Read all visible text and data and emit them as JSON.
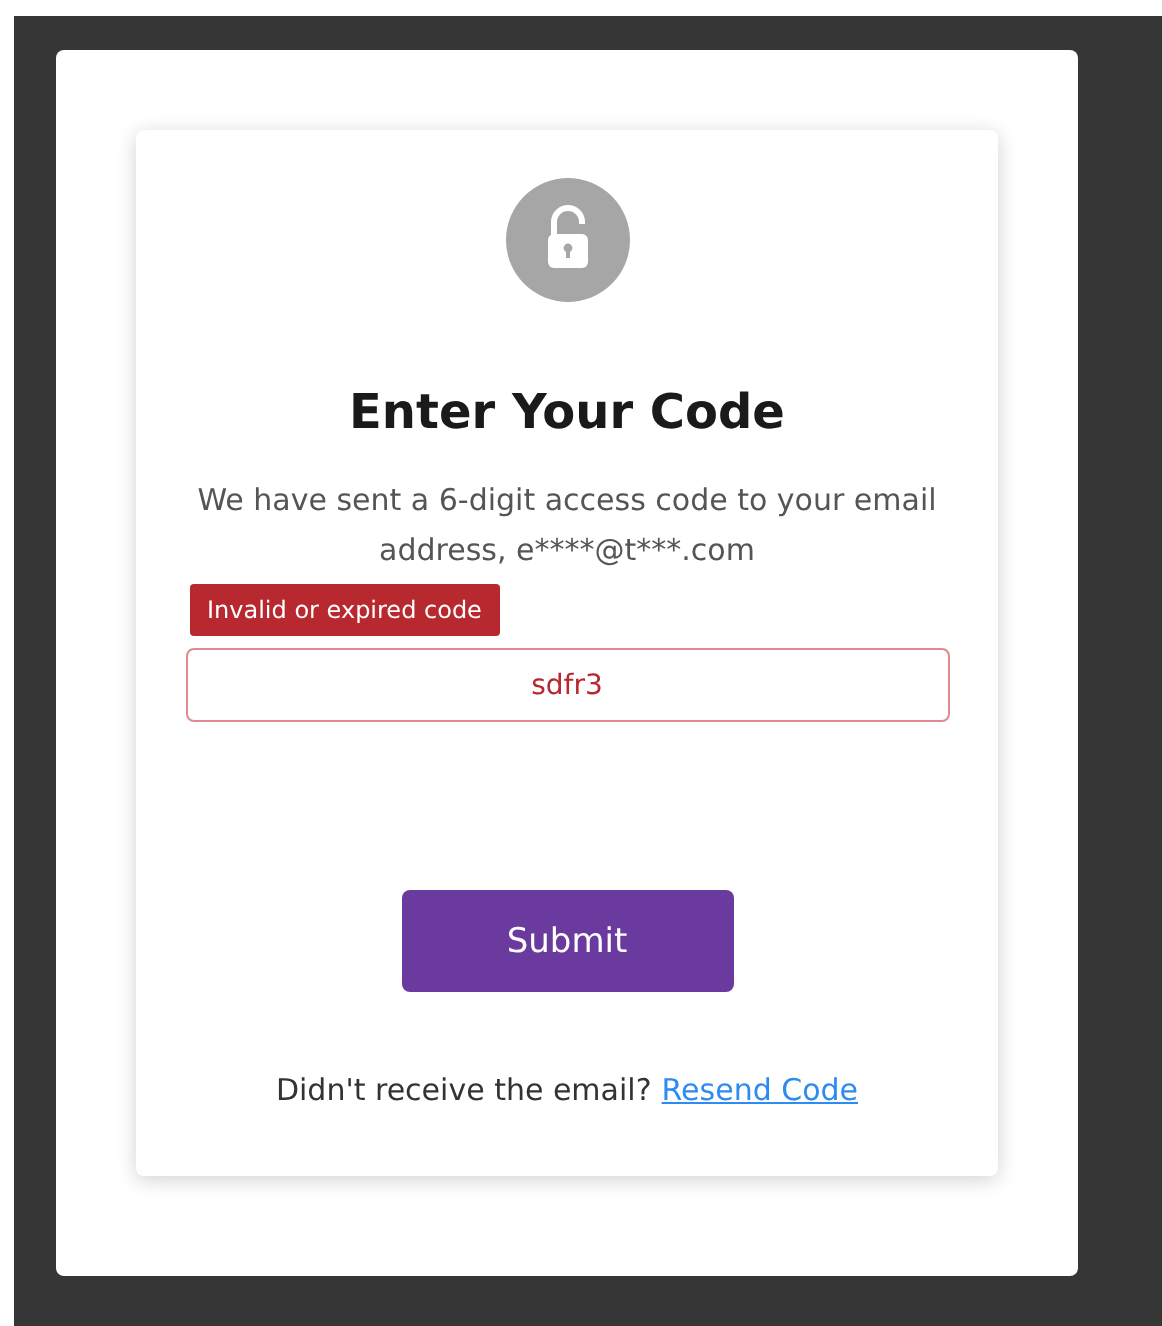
{
  "card": {
    "title": "Enter Your Code",
    "message": "We have sent a 6-digit access code to your email address, e****@t***.com",
    "code_field": {
      "value": "sdfr3",
      "invalid": true,
      "error": "Invalid or expired code"
    },
    "submit_button": "Submit",
    "resend_prompt": "Didn't receive the email?",
    "resend_link": "Resend Code"
  }
}
